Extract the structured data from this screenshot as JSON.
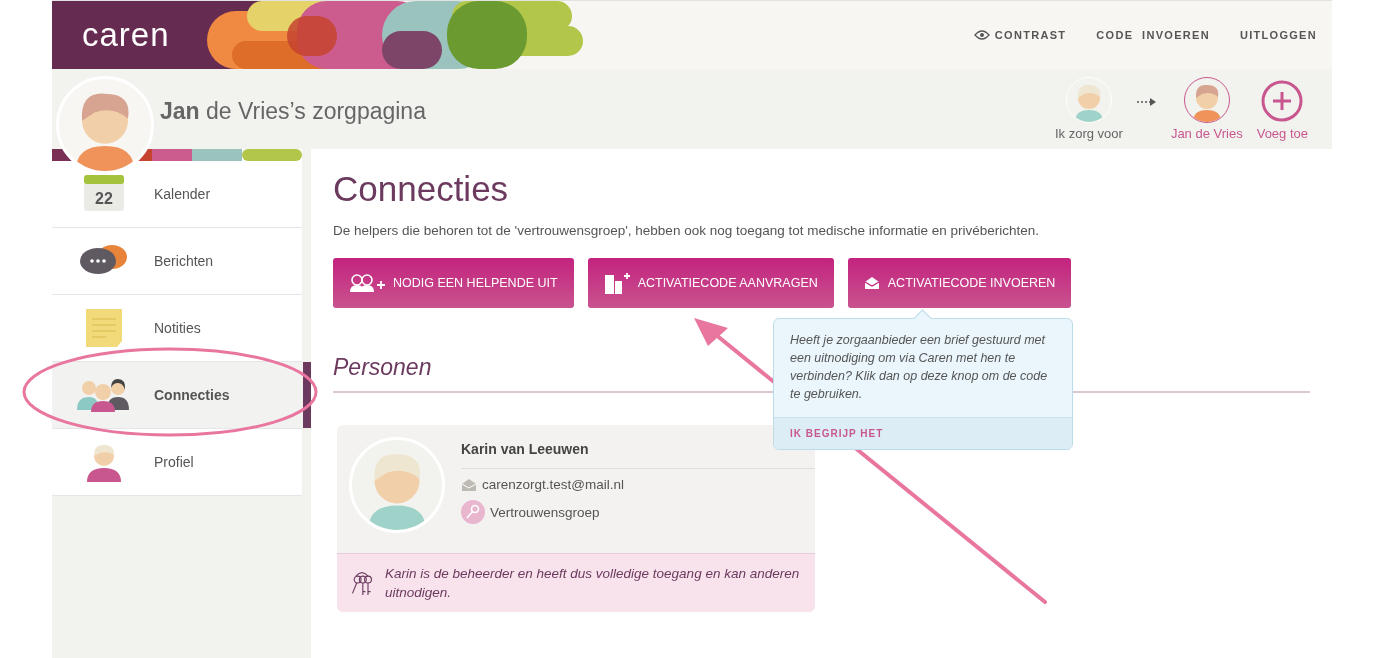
{
  "header": {
    "logo": "caren",
    "links": [
      {
        "label": "CONTRAST",
        "kind": "eye"
      },
      {
        "label": "CODE  INVOEREN",
        "kind": "text"
      },
      {
        "label": "UITLOGGEN",
        "kind": "text"
      }
    ]
  },
  "page_title": "**Jan** de Vries’s zorgpagina",
  "switcher": [
    {
      "label": "Ik zorg voor",
      "kind": "person",
      "selected": false
    },
    {
      "label": "Jan de Vries",
      "kind": "person",
      "selected": true
    },
    {
      "label": "Voeg toe",
      "kind": "add",
      "selected": false
    }
  ],
  "sidebar": {
    "items": [
      {
        "label": "Kalender",
        "kind": "calendar",
        "badge": "22",
        "selected": false
      },
      {
        "label": "Berichten",
        "kind": "messages",
        "selected": false
      },
      {
        "label": "Notities",
        "kind": "notes",
        "selected": false
      },
      {
        "label": "Connecties",
        "kind": "people",
        "selected": true
      },
      {
        "label": "Profiel",
        "kind": "profile",
        "selected": false
      }
    ]
  },
  "main": {
    "title": "Connecties",
    "description": "De helpers die behoren tot de 'vertrouwensgroep', hebben ook nog toegang tot medische informatie en privéberichten.",
    "buttons": [
      {
        "label": "NODIG EEN HELPENDE UIT",
        "kind": "invite"
      },
      {
        "label": "ACTIVATIECODE AANVRAGEN",
        "kind": "building"
      },
      {
        "label": "ACTIVATIECODE INVOEREN",
        "kind": "envelope"
      }
    ],
    "section_title": "Personen",
    "person": {
      "name": "Karin van Leeuwen",
      "email": "carenzorgt.test@mail.nl",
      "group": "Vertrouwensgroep",
      "note": "Karin is de beheerder en heeft dus volledige toegang en kan anderen uitnodigen."
    },
    "tooltip": {
      "text": "Heeft je zorgaanbieder een brief gestuurd met een uitnodiging om via Caren met hen te verbinden? Klik dan op deze knop om de code te gebruiken.",
      "action": "IK BEGRIJP HET"
    }
  }
}
